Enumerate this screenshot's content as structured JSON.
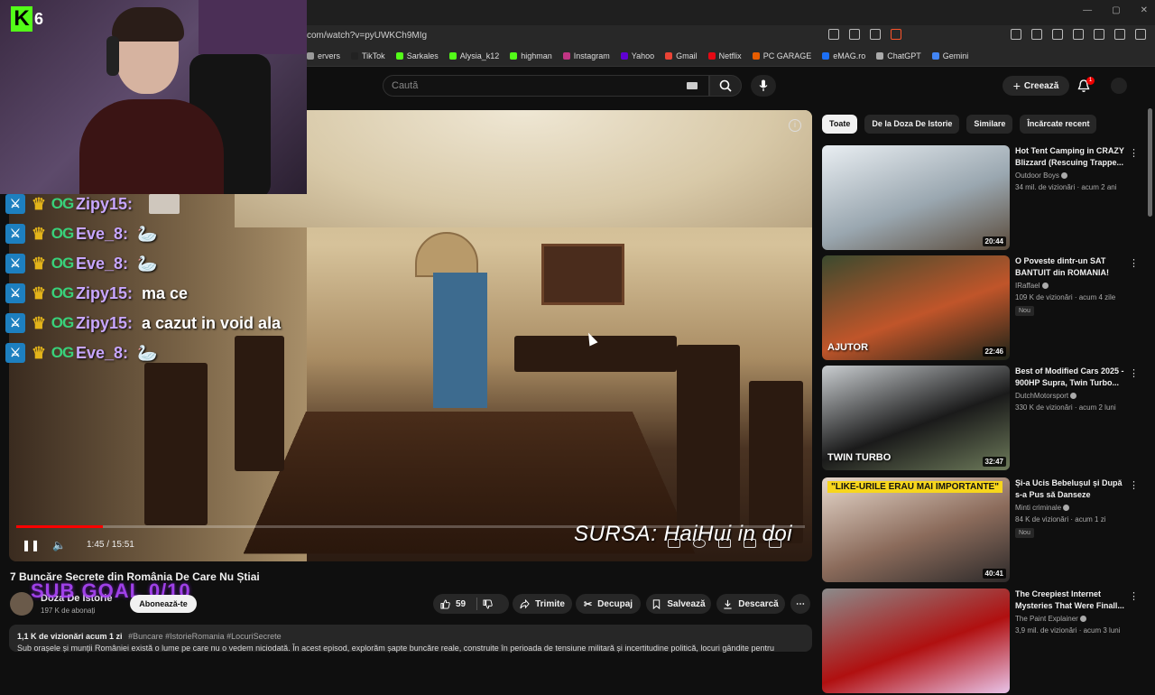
{
  "browser": {
    "url": "com/watch?v=pyUWKCh9MIg",
    "bookmarks": [
      "ervers",
      "TikTok",
      "Sarkales",
      "Alysia_k12",
      "highman",
      "Instagram",
      "Yahoo",
      "Gmail",
      "Netflix",
      "PC GARAGE",
      "eMAG.ro",
      "ChatGPT",
      "Gemini"
    ],
    "bookmark_colors": [
      "#999",
      "#222",
      "#53fc18",
      "#53fc18",
      "#53fc18",
      "#c13584",
      "#6001d2",
      "#ea4335",
      "#e50914",
      "#e85d00",
      "#1c6ff5",
      "#aaa",
      "#4285f4"
    ]
  },
  "header": {
    "search_placeholder": "Caută",
    "create_label": "Creează",
    "notif_count": "1"
  },
  "webcam": {
    "kick_logo": "K",
    "viewer_count": "6"
  },
  "chat": [
    {
      "user": "Zipy15:",
      "msg": "",
      "emote": true
    },
    {
      "user": "Eve_8:",
      "msg": "🦢"
    },
    {
      "user": "Eve_8:",
      "msg": "🦢"
    },
    {
      "user": "Zipy15:",
      "msg": "ma ce"
    },
    {
      "user": "Zipy15:",
      "msg": "a cazut in void ala"
    },
    {
      "user": "Eve_8:",
      "msg": "🦢"
    }
  ],
  "video": {
    "source_watermark": "SURSA: HaiHui in doi",
    "time": "1:45 / 15:51",
    "progress_fraction": 0.11,
    "title": "7 Buncăre Secrete din România De Care Nu Știai",
    "channel": "Doza De Istorie",
    "subscribers": "197 K de abonați",
    "subscribe_label": "Abonează-te",
    "sub_goal": "SUB GOAL 0/10",
    "likes": "59",
    "share_label": "Trimite",
    "clip_label": "Decupaj",
    "save_label": "Salvează",
    "download_label": "Descarcă",
    "views_line": "1,1 K de vizionări  acum 1 zi",
    "hashtags": "#Buncare #IstorieRomania #LocuriSecrete",
    "description": "Sub orașele și munții României există o lume pe care nu o vedem niciodată. În acest episod, explorăm șapte buncăre reale, construite în perioada de tensiune militară și incertitudine politică, locuri gândite pentru"
  },
  "sidebar": {
    "chips": [
      "Toate",
      "De la Doza De Istorie",
      "Similare",
      "Încărcate recent"
    ],
    "videos": [
      {
        "title": "Hot Tent Camping in CRAZY Blizzard (Rescuing Trappe...",
        "channel": "Outdoor Boys",
        "meta": "34 mil. de vizionări · acum 2 ani",
        "duration": "20:44",
        "badge": "",
        "colors": [
          "#e9eef2",
          "#9aa7b0",
          "#5a4a3a"
        ]
      },
      {
        "title": "O Poveste dintr-un SAT BANTUIT din ROMANIA!",
        "channel": "IRaffael",
        "meta": "109 K de vizionări · acum 4 zile",
        "duration": "22:46",
        "badge": "Nou",
        "colors": [
          "#3b4a2e",
          "#c0552a",
          "#1d2318"
        ],
        "overlay": "AJUTOR"
      },
      {
        "title": "Best of Modified Cars 2025 - 900HP Supra, Twin Turbo...",
        "channel": "DutchMotorsport",
        "meta": "330 K de vizionări · acum 2 luni",
        "duration": "32:47",
        "badge": "",
        "colors": [
          "#c9cdd0",
          "#1a1a1a",
          "#6d7a5a"
        ],
        "overlay": "TWIN TURBO"
      },
      {
        "title": "Și-a Ucis Bebelușul și După s-a Pus să Danseze Pentru...",
        "channel": "Minti criminale",
        "meta": "84 K de vizionări · acum 1 zi",
        "duration": "40:41",
        "badge": "Nou",
        "colors": [
          "#e6d8cc",
          "#8b6b5b",
          "#2d2a2a"
        ],
        "overlay": "\"LIKE-URILE ERAU MAI IMPORTANTE\""
      },
      {
        "title": "The Creepiest Internet Mysteries That Were Finall...",
        "channel": "The Paint Explainer",
        "meta": "3,9 mil. de vizionări · acum 3 luni",
        "duration": "",
        "badge": "",
        "colors": [
          "#8b8b8b",
          "#b01010",
          "#e8c3e8"
        ]
      }
    ]
  }
}
